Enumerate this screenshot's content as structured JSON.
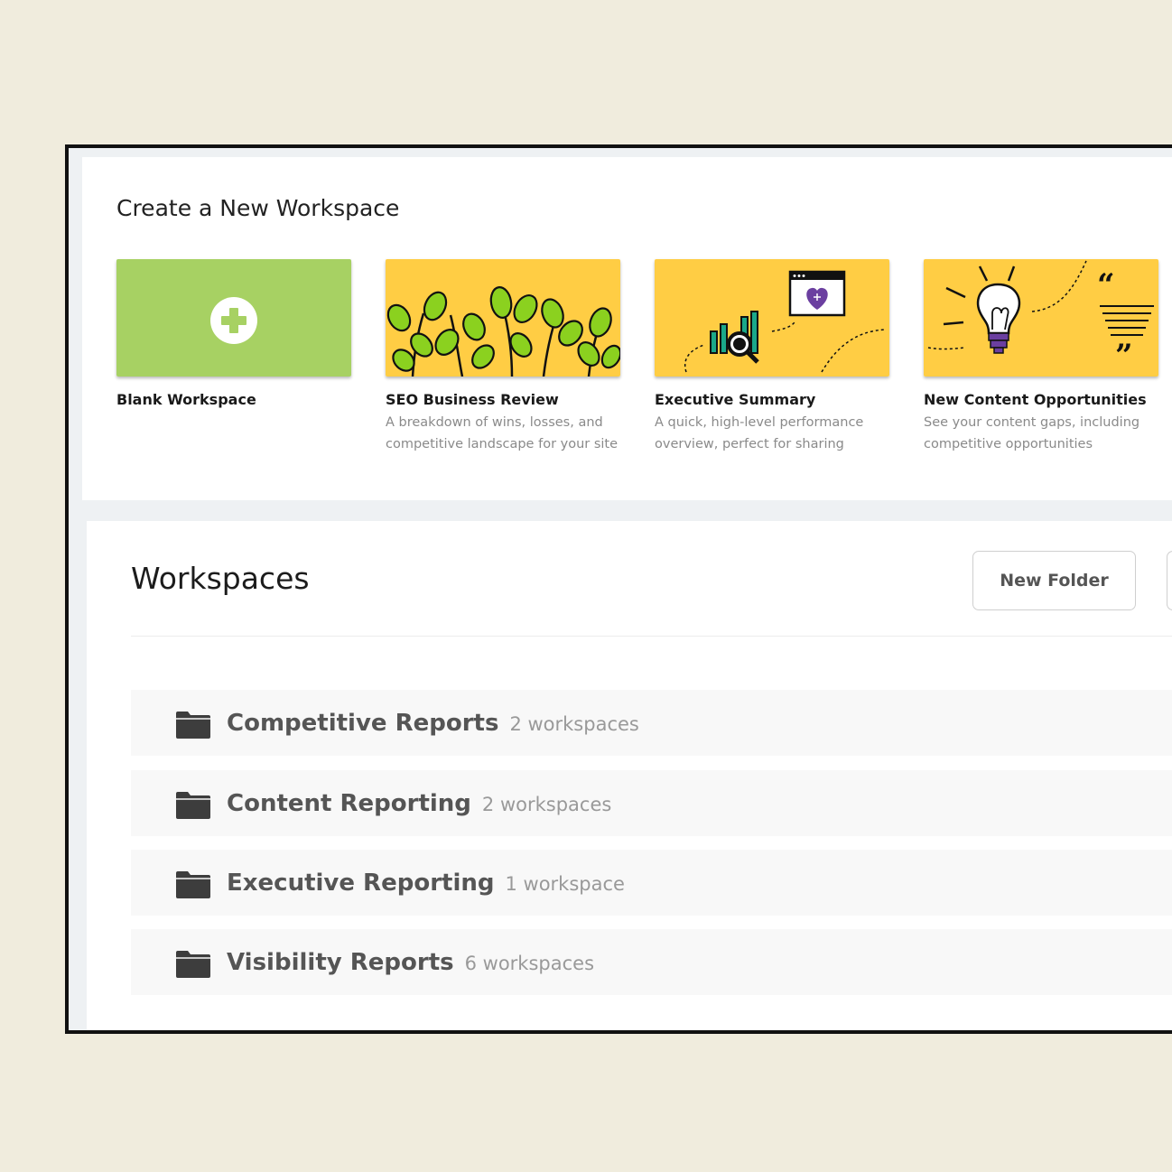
{
  "create_section": {
    "title": "Create a New Workspace",
    "templates": [
      {
        "name": "Blank Workspace",
        "description": "",
        "line1": "",
        "line2": "",
        "image": "plus-circle-icon",
        "bg": "#a7d163"
      },
      {
        "name": "SEO Business Review",
        "line1": "A breakdown of wins, losses, and",
        "line2": "competitive landscape for your site",
        "image": "plant-illustration",
        "bg": "#ffcd44"
      },
      {
        "name": "Executive Summary",
        "line1": "A quick, high-level performance",
        "line2": "overview, perfect for sharing",
        "image": "chart-magnifier-illustration",
        "bg": "#ffcd44"
      },
      {
        "name": "New Content Opportunities",
        "line1": "See your content gaps, including",
        "line2": "competitive opportunities",
        "image": "lightbulb-illustration",
        "bg": "#ffcd44"
      }
    ]
  },
  "workspaces_section": {
    "title": "Workspaces",
    "new_folder_label": "New Folder",
    "folders": [
      {
        "name": "Competitive Reports",
        "count": "2 workspaces"
      },
      {
        "name": "Content Reporting",
        "count": "2 workspaces"
      },
      {
        "name": "Executive Reporting",
        "count": "1 workspace"
      },
      {
        "name": "Visibility Reports",
        "count": "6 workspaces"
      }
    ]
  },
  "colors": {
    "page_bg": "#f0ecdd",
    "blank_green": "#a7d163",
    "template_yellow": "#ffcd44",
    "accent_purple": "#6b3fa0",
    "leaf_green": "#8bd11f"
  }
}
